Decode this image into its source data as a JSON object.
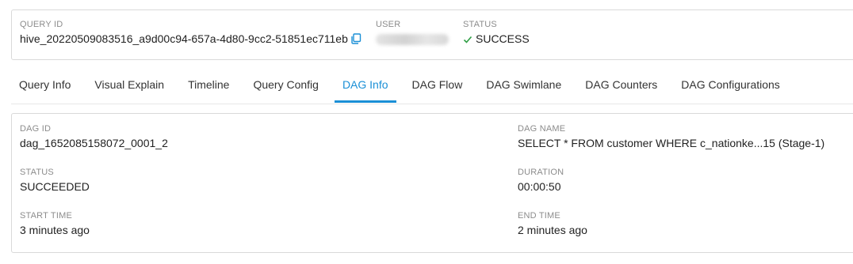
{
  "header": {
    "query_id_label": "QUERY ID",
    "query_id_value": "hive_20220509083516_a9d00c94-657a-4d80-9cc2-51851ec711eb",
    "user_label": "USER",
    "status_label": "STATUS",
    "status_value": "SUCCESS",
    "status_color": "#2e9e44"
  },
  "tabs": [
    {
      "label": "Query Info"
    },
    {
      "label": "Visual Explain"
    },
    {
      "label": "Timeline"
    },
    {
      "label": "Query Config"
    },
    {
      "label": "DAG Info",
      "active": true
    },
    {
      "label": "DAG Flow"
    },
    {
      "label": "DAG Swimlane"
    },
    {
      "label": "DAG Counters"
    },
    {
      "label": "DAG Configurations"
    }
  ],
  "dag": {
    "dag_id_label": "DAG ID",
    "dag_id_value": "dag_1652085158072_0001_2",
    "dag_name_label": "DAG NAME",
    "dag_name_value": "SELECT * FROM customer WHERE c_nationke...15 (Stage-1)",
    "status_label": "STATUS",
    "status_value": "SUCCEEDED",
    "duration_label": "DURATION",
    "duration_value": "00:00:50",
    "start_time_label": "START TIME",
    "start_time_value": "3 minutes ago",
    "end_time_label": "END TIME",
    "end_time_value": "2 minutes ago"
  },
  "accent_color": "#1a8fd6"
}
